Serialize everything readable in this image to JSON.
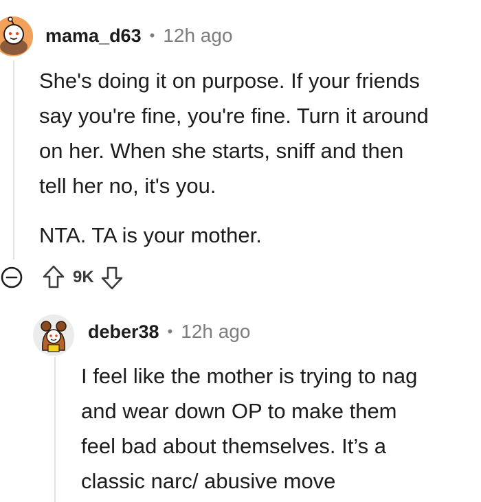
{
  "comments": [
    {
      "username": "mama_d63",
      "separator": "•",
      "time": "12h ago",
      "avatar_icon": "snoo-avatar-orange",
      "paragraphs": [
        [
          "She's doing it on purpose. If your friends",
          "say you're fine, you're fine. Turn it around",
          "on her. When she starts, sniff and then",
          "tell her no, it's you."
        ],
        [
          "NTA. TA is your mother."
        ]
      ],
      "votes": "9K"
    },
    {
      "username": "deber38",
      "separator": "•",
      "time": "12h ago",
      "avatar_icon": "snoo-avatar-bear-costume",
      "paragraphs": [
        [
          "I feel like the mother is trying to nag",
          "and wear down OP to make them",
          "feel bad about themselves. It’s a",
          "classic narc/ abusive move"
        ]
      ]
    }
  ],
  "icons": {
    "collapse": "collapse-minus-icon",
    "upvote": "upvote-arrow-icon",
    "downvote": "downvote-arrow-icon"
  },
  "colors": {
    "text": "#1c1c1c",
    "meta": "#7c7c7c",
    "thread_line": "#e3e3e3"
  }
}
